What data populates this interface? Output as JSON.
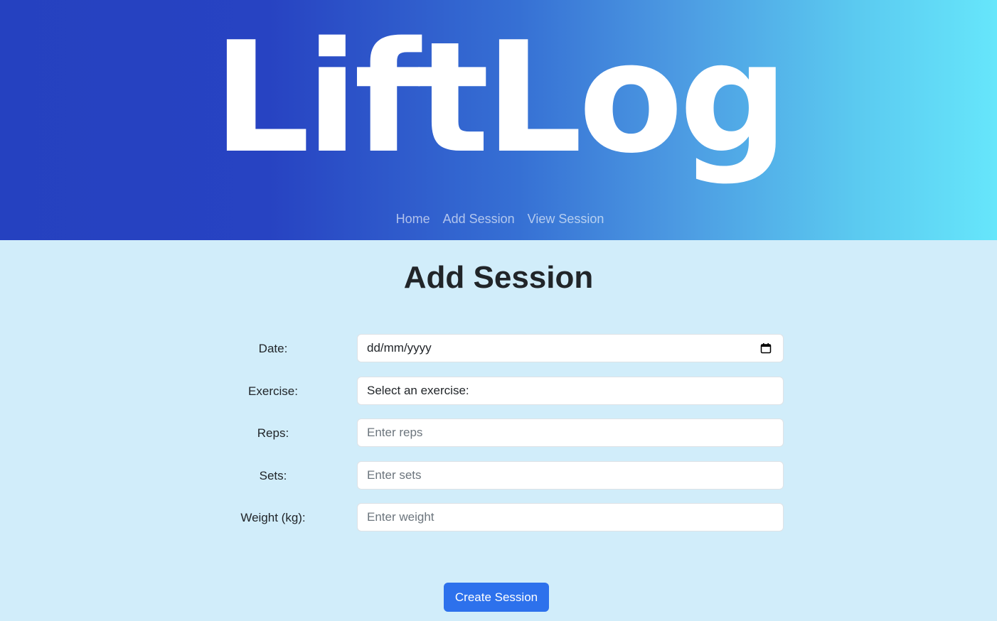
{
  "header": {
    "logo_text": "LiftLog",
    "nav": [
      {
        "label": "Home"
      },
      {
        "label": "Add Session"
      },
      {
        "label": "View Session"
      }
    ]
  },
  "page": {
    "title": "Add Session"
  },
  "form": {
    "date": {
      "label": "Date:",
      "value": "dd/mm/yyyy"
    },
    "exercise": {
      "label": "Exercise:",
      "value": "Select an exercise:"
    },
    "reps": {
      "label": "Reps:",
      "placeholder": "Enter reps"
    },
    "sets": {
      "label": "Sets:",
      "placeholder": "Enter sets"
    },
    "weight": {
      "label": "Weight (kg):",
      "placeholder": "Enter weight"
    },
    "submit_label": "Create Session"
  },
  "icons": {
    "date_picker": "calendar-icon"
  },
  "colors": {
    "header_gradient_start": "#2541c0",
    "header_gradient_end": "#66e6fb",
    "page_background": "#d1edfa",
    "primary_button": "#2d71ec"
  }
}
